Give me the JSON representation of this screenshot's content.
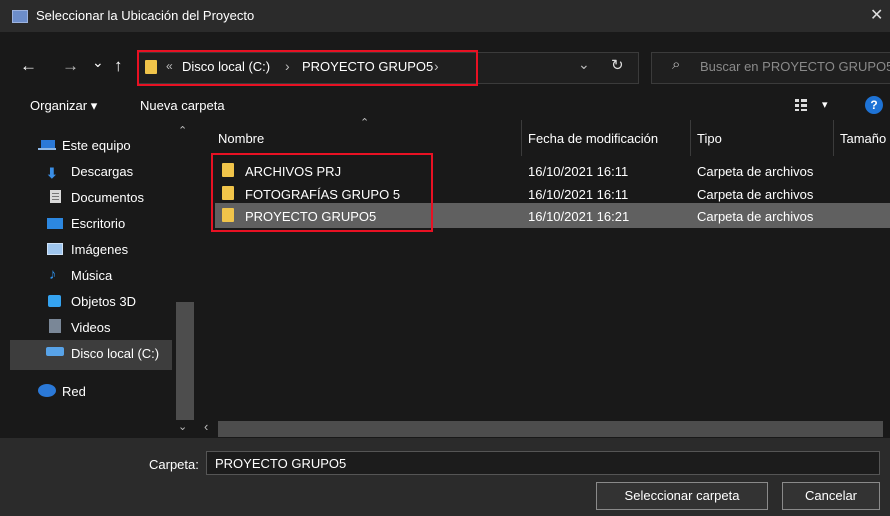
{
  "window": {
    "title": "Seleccionar la Ubicación del Proyecto",
    "close": "✕"
  },
  "nav": {
    "back": "←",
    "forward": "→",
    "recent": "⌄",
    "up": "↑"
  },
  "address": {
    "overflow": "«",
    "crumbs": [
      "Disco local (C:)",
      "PROYECTO GRUPO5"
    ],
    "sep": "›",
    "dropdown": "⌄",
    "refresh": "↻"
  },
  "search": {
    "placeholder": "Buscar en PROYECTO GRUPO5",
    "icon": "⌕"
  },
  "toolbar": {
    "organize": "Organizar ▾",
    "new_folder": "Nueva carpeta",
    "view": "▾",
    "help": "?"
  },
  "sidebar": {
    "items": [
      {
        "label": "Este equipo",
        "icon": "computer-icon",
        "color": "#2b79d8"
      },
      {
        "label": "Descargas",
        "icon": "download-icon",
        "color": "#3a8ee6"
      },
      {
        "label": "Documentos",
        "icon": "document-icon",
        "color": "#d9d9d9"
      },
      {
        "label": "Escritorio",
        "icon": "desktop-icon",
        "color": "#2c87e0"
      },
      {
        "label": "Imágenes",
        "icon": "pictures-icon",
        "color": "#9fc6ee"
      },
      {
        "label": "Música",
        "icon": "music-icon",
        "color": "#2e8fe8"
      },
      {
        "label": "Objetos 3D",
        "icon": "objects-3d-icon",
        "color": "#35a3f0"
      },
      {
        "label": "Videos",
        "icon": "video-icon",
        "color": "#7a8797"
      },
      {
        "label": "Disco local (C:)",
        "icon": "drive-icon",
        "color": "#58a3e8"
      },
      {
        "label": "Red",
        "icon": "network-icon",
        "color": "#2b79d8"
      }
    ]
  },
  "list": {
    "columns": [
      "Nombre",
      "Fecha de modificación",
      "Tipo",
      "Tamaño"
    ],
    "sort_indicator": "⌃",
    "rows": [
      {
        "name": "ARCHIVOS PRJ",
        "date": "16/10/2021 16:11",
        "type": "Carpeta de archivos"
      },
      {
        "name": "FOTOGRAFÍAS GRUPO 5",
        "date": "16/10/2021 16:11",
        "type": "Carpeta de archivos"
      },
      {
        "name": "PROYECTO GRUPO5",
        "date": "16/10/2021 16:21",
        "type": "Carpeta de archivos"
      }
    ]
  },
  "scroll": {
    "up": "⌃",
    "down": "⌄",
    "left": "‹",
    "right": "›"
  },
  "footer": {
    "folder_label": "Carpeta:",
    "folder_value": "PROYECTO GRUPO5",
    "select_button": "Seleccionar carpeta",
    "cancel_button": "Cancelar"
  },
  "colors": {
    "highlight": "#e81123",
    "accent": "#1e73d6",
    "folder": "#f0c44a"
  }
}
